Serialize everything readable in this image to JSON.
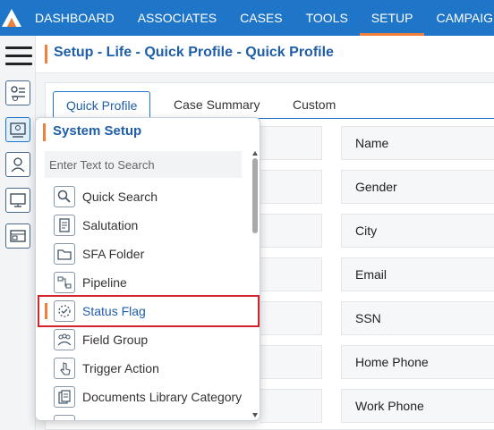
{
  "nav": {
    "items": [
      "DASHBOARD",
      "ASSOCIATES",
      "CASES",
      "TOOLS",
      "SETUP",
      "CAMPAIGN"
    ],
    "active": "SETUP"
  },
  "header": {
    "title": "Setup - Life - Quick Profile - Quick Profile"
  },
  "tabs": [
    "Quick Profile",
    "Case Summary",
    "Custom"
  ],
  "fields": [
    "Name",
    "Gender",
    "City",
    "Email",
    "SSN",
    "Home Phone",
    "Work Phone"
  ],
  "flyout": {
    "title": "System Setup",
    "search_placeholder": "Enter Text to Search",
    "items": [
      {
        "label": "Quick Search",
        "icon": "magnifier-icon"
      },
      {
        "label": "Salutation",
        "icon": "document-icon"
      },
      {
        "label": "SFA Folder",
        "icon": "folder-icon"
      },
      {
        "label": "Pipeline",
        "icon": "pipeline-icon"
      },
      {
        "label": "Status Flag",
        "icon": "status-flag-icon"
      },
      {
        "label": "Field Group",
        "icon": "group-icon"
      },
      {
        "label": "Trigger Action",
        "icon": "pointer-icon"
      },
      {
        "label": "Documents Library Category",
        "icon": "library-icon"
      }
    ],
    "selected": "Status Flag"
  },
  "colors": {
    "brand": "#1f76c9",
    "accent": "#f07f3c",
    "selection": "#d4232d"
  }
}
